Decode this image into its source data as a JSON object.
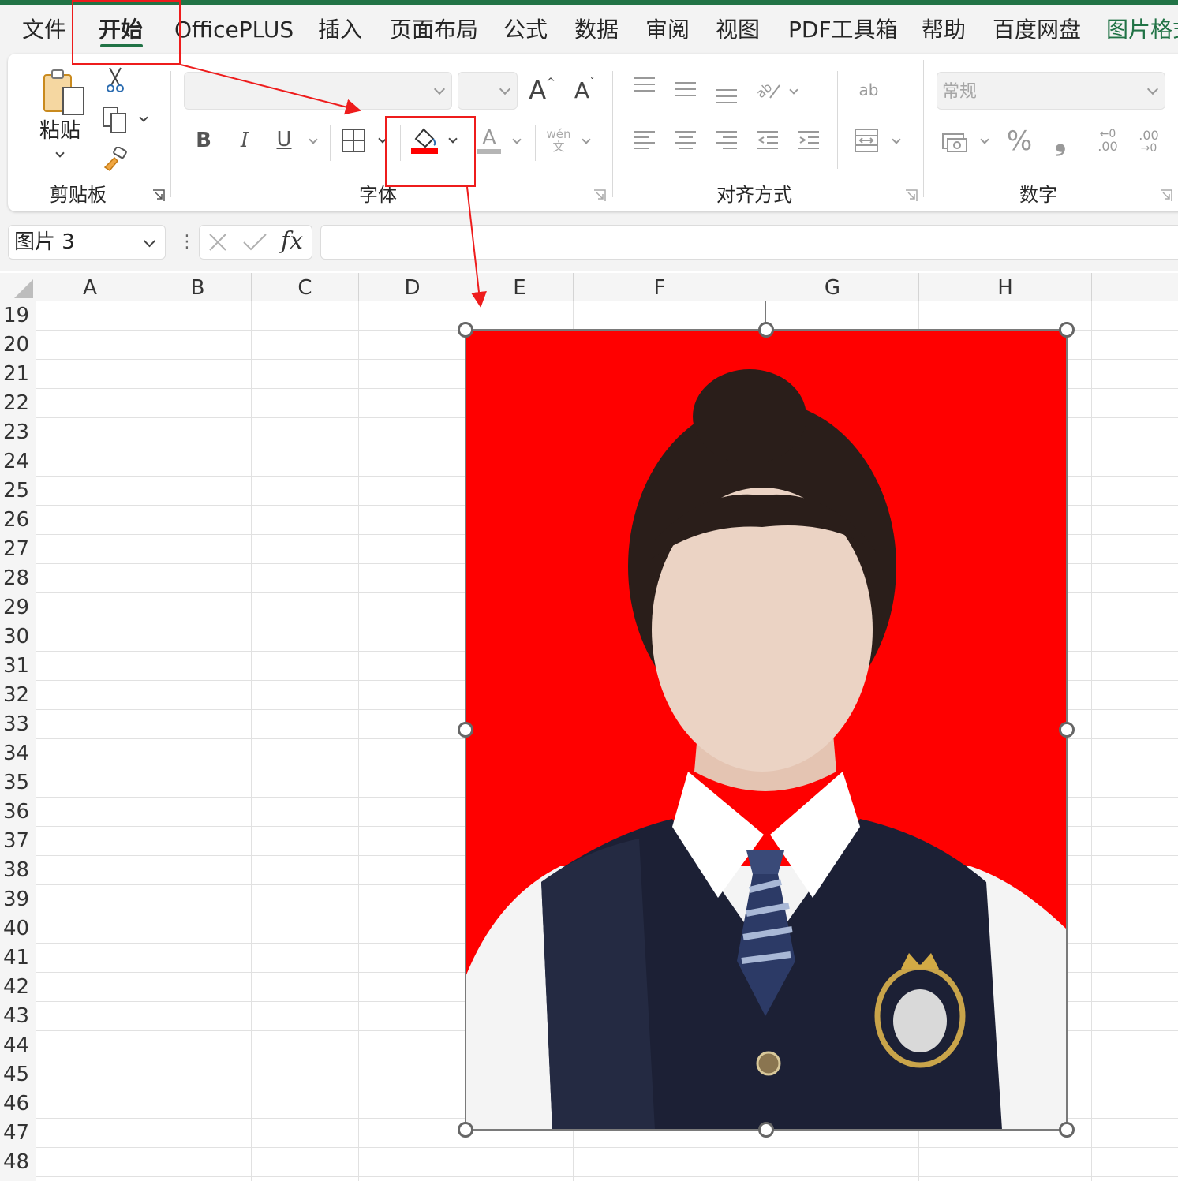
{
  "tabs": [
    "文件",
    "开始",
    "OfficePLUS",
    "插入",
    "页面布局",
    "公式",
    "数据",
    "审阅",
    "视图",
    "PDF工具箱",
    "帮助",
    "百度网盘",
    "图片格式"
  ],
  "active_tab": "开始",
  "ribbon": {
    "clipboard": {
      "paste_label": "粘贴",
      "group_label": "剪贴板"
    },
    "font": {
      "font_name": "",
      "font_size": "",
      "grow_label": "A",
      "shrink_label": "A",
      "bold": "B",
      "italic": "I",
      "underline": "U",
      "font_color_letter": "A",
      "phonetic_top": "wén",
      "phonetic_bottom": "文",
      "group_label": "字体",
      "fill_color": "#ff0000"
    },
    "alignment": {
      "wrap_text": "ab",
      "group_label": "对齐方式"
    },
    "number": {
      "format": "常规",
      "percent": "%",
      "comma": "❟",
      "increase_decimal": ".00",
      "decrease_decimal": ".00",
      "group_label": "数字"
    }
  },
  "formula_bar": {
    "name_box": "图片 3",
    "fx": "fx",
    "formula": ""
  },
  "columns": [
    "A",
    "B",
    "C",
    "D",
    "E",
    "F",
    "G",
    "H"
  ],
  "rows": [
    "19",
    "20",
    "21",
    "22",
    "23",
    "24",
    "25",
    "26",
    "27",
    "28",
    "29",
    "30",
    "31",
    "32",
    "33",
    "34",
    "35",
    "36",
    "37",
    "38",
    "39",
    "40",
    "41",
    "42",
    "43",
    "44",
    "45",
    "46",
    "47",
    "48"
  ],
  "picture": {
    "background": "#ff0000",
    "name": "图片 3"
  },
  "colors": {
    "accent": "#217346",
    "annotation": "#ee1c1c"
  }
}
